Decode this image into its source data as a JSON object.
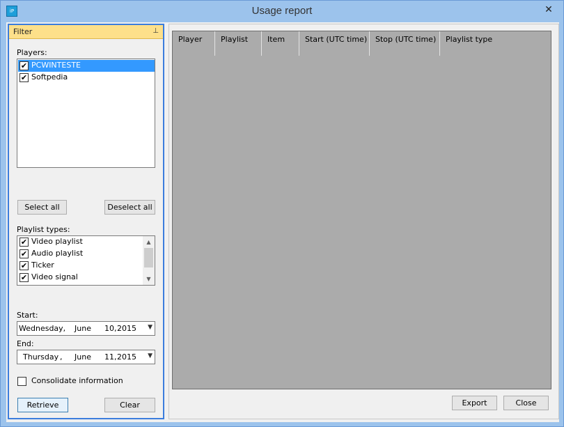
{
  "window": {
    "title": "Usage report",
    "icon": "app-logo-icon",
    "close_glyph": "✕",
    "icon_text": "iP"
  },
  "filter": {
    "title": "Filter",
    "players_label": "Players:",
    "players": [
      {
        "label": "PCWINTESTE",
        "checked": true,
        "selected": true
      },
      {
        "label": "Softpedia",
        "checked": true,
        "selected": false
      }
    ],
    "select_all_label": "Select all",
    "deselect_all_label": "Deselect all",
    "playlist_types_label": "Playlist types:",
    "playlist_types": [
      {
        "label": "Video playlist",
        "checked": true
      },
      {
        "label": "Audio playlist",
        "checked": true
      },
      {
        "label": "Ticker",
        "checked": true
      },
      {
        "label": "Video signal",
        "checked": true
      }
    ],
    "start_label": "Start:",
    "start": {
      "weekday": "Wednesday,",
      "month": "June",
      "day": "10,",
      "year": "2015"
    },
    "end_label": "End:",
    "end": {
      "weekday": "Thursday",
      "sep": ",",
      "month": "June",
      "day": "11,",
      "year": "2015"
    },
    "consolidate_label": "Consolidate information",
    "consolidate_checked": false,
    "retrieve_label": "Retrieve",
    "clear_label": "Clear"
  },
  "grid": {
    "columns": [
      "Player",
      "Playlist",
      "Item",
      "Start (UTC time)",
      "Stop (UTC time)",
      "Playlist type"
    ],
    "rows": []
  },
  "actions": {
    "export_label": "Export",
    "close_label": "Close"
  },
  "colors": {
    "accent": "#3b7ddd",
    "filter_header": "#fde08a",
    "selection": "#3399ff",
    "grid_bg": "#ababab",
    "window_frame": "#9cc3ec"
  }
}
